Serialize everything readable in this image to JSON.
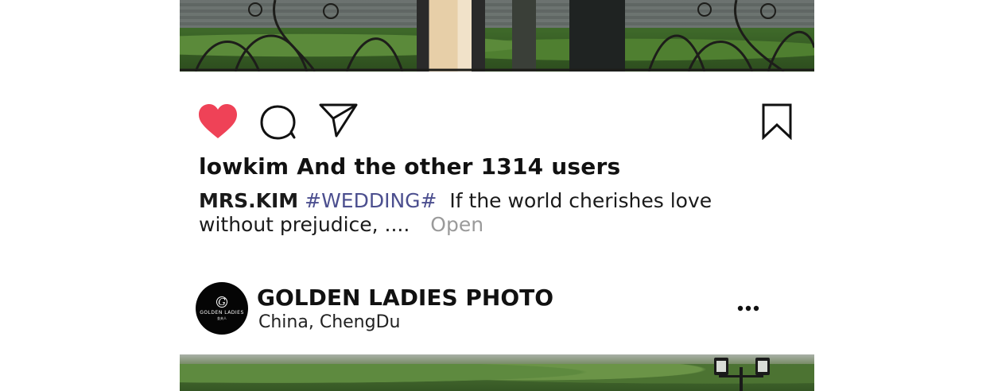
{
  "post1": {
    "actions": {
      "like_icon": "heart-filled",
      "comment_icon": "speech-bubble",
      "share_icon": "paper-plane",
      "save_icon": "bookmark",
      "like_color": "#ef4257"
    },
    "likes_text": "lowkim And the other 1314 users",
    "caption": {
      "username": "MRS.KIM",
      "hashtag": "#WEDDING#",
      "text": "If the world cherishes love without prejudice, ....",
      "more_label": "Open"
    }
  },
  "post2": {
    "avatar": {
      "brand": "GOLDEN LADIES",
      "sub": "金夫人"
    },
    "account_name": "GOLDEN LADIES PHOTO",
    "location": "China,  ChengDu",
    "menu_icon": "more-dots"
  }
}
